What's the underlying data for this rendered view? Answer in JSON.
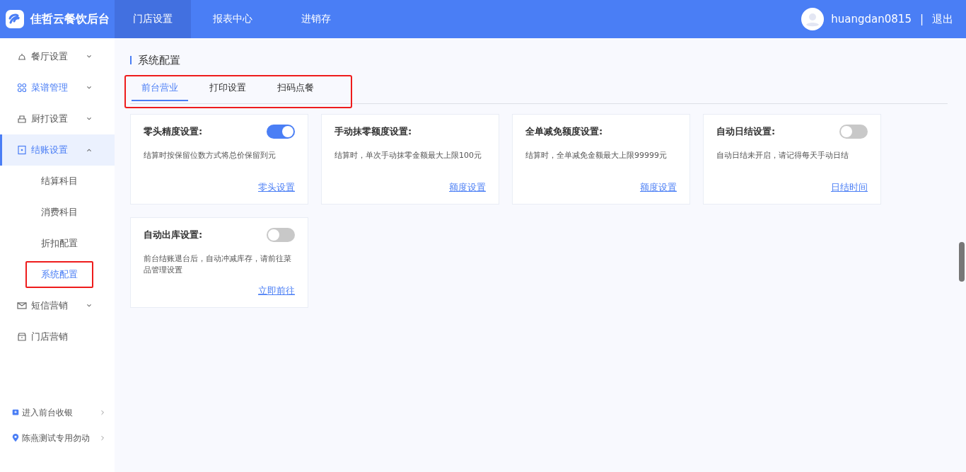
{
  "header": {
    "brand": "佳哲云餐饮后台",
    "nav": [
      {
        "label": "门店设置",
        "selected": true
      },
      {
        "label": "报表中心",
        "selected": false
      },
      {
        "label": "进销存",
        "selected": false
      }
    ],
    "user": "huangdan0815",
    "separator": "|",
    "logout": "退出"
  },
  "sidebar": {
    "items": [
      {
        "label": "餐厅设置",
        "selected": false,
        "expanded": false
      },
      {
        "label": "菜谱管理",
        "selected": true,
        "expanded": false
      },
      {
        "label": "厨打设置",
        "selected": false,
        "expanded": false
      },
      {
        "label": "结账设置",
        "selected": true,
        "expanded": true,
        "children": [
          {
            "label": "结算科目",
            "selected": false,
            "highlighted": false
          },
          {
            "label": "消费科目",
            "selected": false,
            "highlighted": false
          },
          {
            "label": "折扣配置",
            "selected": false,
            "highlighted": false
          },
          {
            "label": "系统配置",
            "selected": true,
            "highlighted": true
          }
        ]
      },
      {
        "label": "短信营销",
        "selected": false,
        "expanded": false
      },
      {
        "label": "门店营销",
        "selected": false
      }
    ],
    "footer": [
      {
        "label": "进入前台收银"
      },
      {
        "label": "陈燕测试专用勿动"
      }
    ]
  },
  "page": {
    "title": "系统配置",
    "tabs_highlighted": true,
    "tabs": [
      {
        "label": "前台营业",
        "selected": true
      },
      {
        "label": "打印设置",
        "selected": false
      },
      {
        "label": "扫码点餐",
        "selected": false
      }
    ],
    "cards": [
      {
        "kind": "switch",
        "title": "零头精度设置:",
        "on": true,
        "description": "结算时按保留位数方式将总价保留到元",
        "link": "零头设置"
      },
      {
        "kind": "plain",
        "title": "手动抹零额度设置:",
        "description": "结算时，单次手动抹零金额最大上限100元",
        "link": "额度设置"
      },
      {
        "kind": "plain",
        "title": "全单减免额度设置:",
        "description": "结算时，全单减免金额最大上限99999元",
        "link": "额度设置"
      },
      {
        "kind": "switch",
        "title": "自动日结设置:",
        "on": false,
        "description": "自动日结未开启，请记得每天手动日结",
        "link": "日结时间"
      },
      {
        "kind": "switch",
        "title": "自动出库设置:",
        "on": false,
        "description": "前台结账退台后，自动冲减库存，请前往菜品管理设置",
        "link": "立即前往"
      }
    ]
  }
}
